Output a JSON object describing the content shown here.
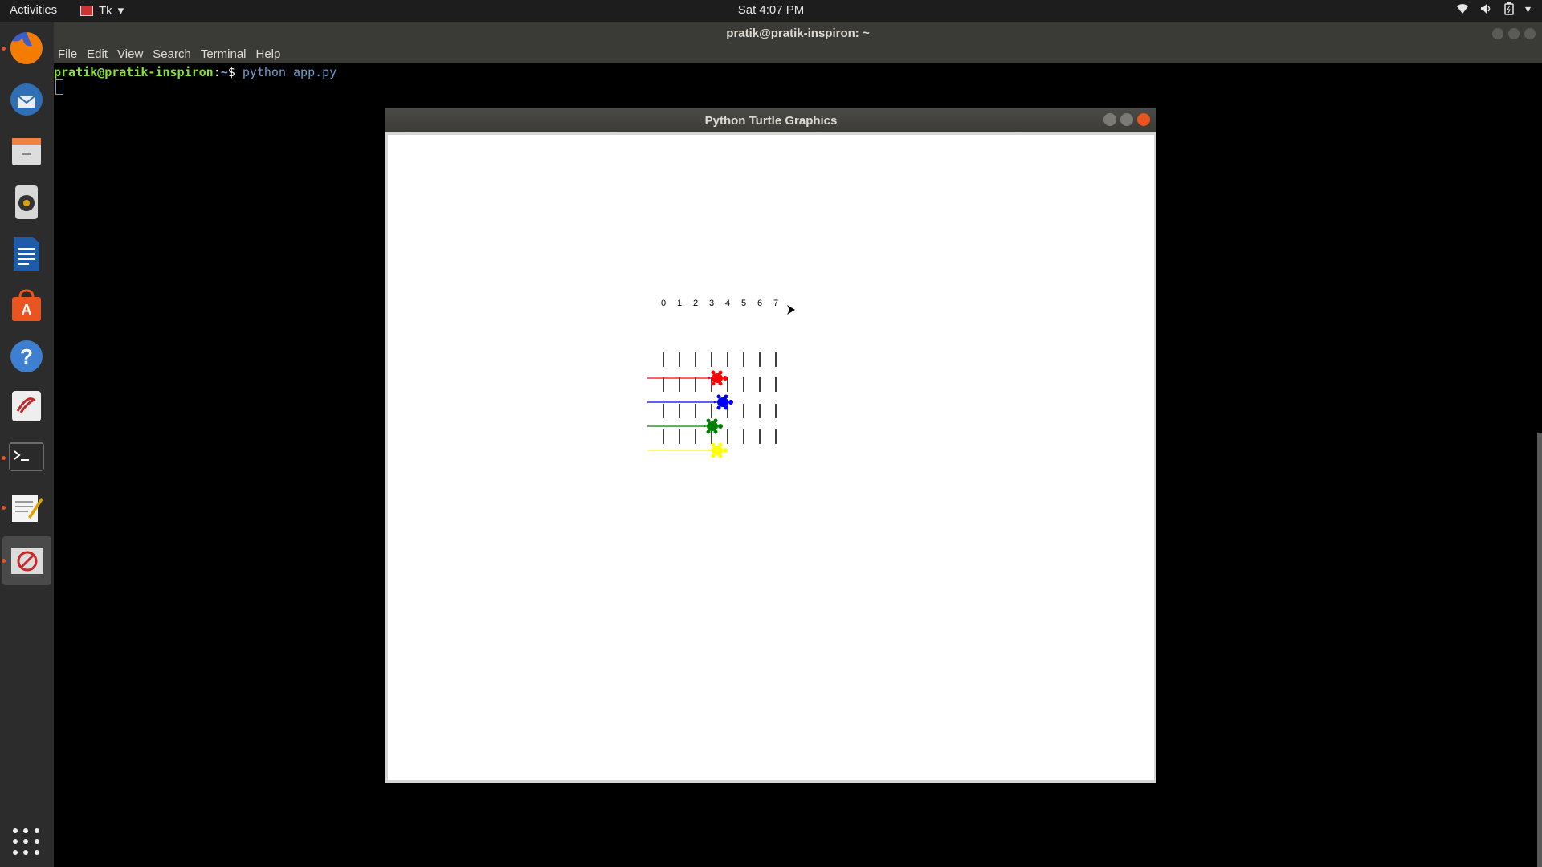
{
  "topbar": {
    "activities": "Activities",
    "app_name": "Tk",
    "clock": "Sat  4:07 PM",
    "tray_icons": [
      "wifi-icon",
      "volume-icon",
      "battery-icon",
      "chevron-down-icon"
    ]
  },
  "dock": {
    "apps": [
      "firefox",
      "thunderbird",
      "files",
      "rhythmbox",
      "libreoffice-writer",
      "software-center",
      "help",
      "document-viewer",
      "terminal",
      "text-editor",
      "tk-app"
    ],
    "running": [
      "firefox",
      "terminal",
      "text-editor",
      "tk-app"
    ],
    "active": "tk-app"
  },
  "terminal": {
    "title": "pratik@pratik-inspiron: ~",
    "menu": [
      "File",
      "Edit",
      "View",
      "Search",
      "Terminal",
      "Help"
    ],
    "prompt_user": "pratik@pratik-inspiron",
    "prompt_sep": ":",
    "prompt_path": "~",
    "prompt_dollar": "$ ",
    "command": "python app.py"
  },
  "turtle_window": {
    "title": "Python Turtle Graphics"
  },
  "race": {
    "track_numbers": [
      "0",
      "1",
      "2",
      "3",
      "4",
      "5",
      "6",
      "7"
    ],
    "turtles": [
      {
        "color": "#ff0000",
        "position": 3.35
      },
      {
        "color": "#0000ff",
        "position": 3.7
      },
      {
        "color": "#008000",
        "position": 3.05
      },
      {
        "color": "#ffff00",
        "position": 3.35
      }
    ]
  }
}
